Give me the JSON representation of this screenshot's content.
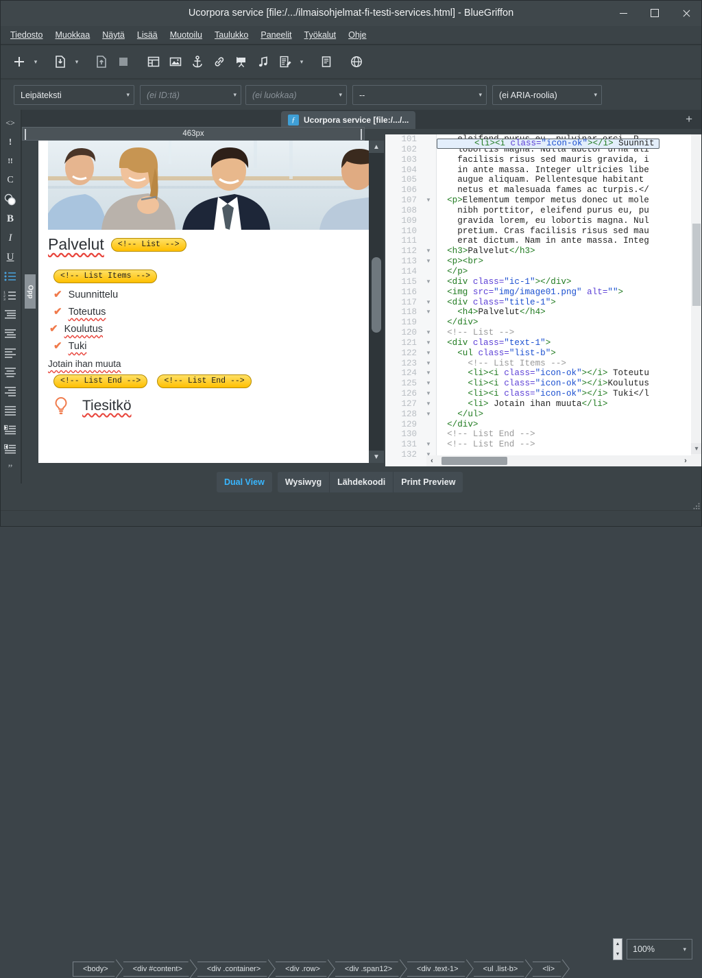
{
  "window": {
    "title": "Ucorpora service [file:/.../ilmaisohjelmat-fi-testi-services.html] - BlueGriffon",
    "minimize": "–",
    "maximize": "❐",
    "close": "✕"
  },
  "menu": {
    "items": [
      {
        "label": "Tiedosto"
      },
      {
        "label": "Muokkaa"
      },
      {
        "label": "Näytä"
      },
      {
        "label": "Lisää"
      },
      {
        "label": "Muotoilu"
      },
      {
        "label": "Taulukko"
      },
      {
        "label": "Paneelit"
      },
      {
        "label": "Työkalut"
      },
      {
        "label": "Ohje"
      }
    ]
  },
  "toolbar": {
    "buttons": [
      {
        "name": "new-document-icon",
        "glyph": "plus"
      },
      {
        "name": "new-document-dropdown-icon",
        "glyph": "caret"
      },
      {
        "name": "open-document-icon",
        "glyph": "doc-down"
      },
      {
        "name": "open-document-dropdown-icon",
        "glyph": "caret"
      },
      {
        "name": "save-document-icon",
        "glyph": "doc-up"
      },
      {
        "name": "stop-icon",
        "glyph": "square"
      },
      {
        "name": "insert-table-icon",
        "glyph": "table"
      },
      {
        "name": "insert-image-icon",
        "glyph": "image"
      },
      {
        "name": "insert-anchor-icon",
        "glyph": "anchor"
      },
      {
        "name": "insert-link-icon",
        "glyph": "link"
      },
      {
        "name": "insert-video-icon",
        "glyph": "video"
      },
      {
        "name": "insert-audio-icon",
        "glyph": "audio"
      },
      {
        "name": "insert-form-icon",
        "glyph": "form"
      },
      {
        "name": "insert-form-dropdown-icon",
        "glyph": "caret"
      },
      {
        "name": "page-properties-icon",
        "glyph": "page"
      },
      {
        "name": "browser-preview-icon",
        "glyph": "globe"
      }
    ]
  },
  "propertybar": {
    "format": {
      "value": "Leipäteksti",
      "placeholder": ""
    },
    "id": {
      "value": "",
      "placeholder": "(ei ID:tä)"
    },
    "class": {
      "value": "",
      "placeholder": "(ei luokkaa)"
    },
    "misc": {
      "value": "--",
      "placeholder": ""
    },
    "aria": {
      "value": "(ei ARIA-roolia)",
      "placeholder": ""
    }
  },
  "tabstrip": {
    "tab_label": "Ucorpora service [file:/.../...",
    "tab_icon": "flash-icon",
    "new_tab": "+"
  },
  "rail": {
    "items": [
      {
        "name": "source-code-icon",
        "glyph": "<>"
      },
      {
        "name": "exclamation-icon",
        "glyph": "!"
      },
      {
        "name": "double-exclamation-icon",
        "glyph": "!!"
      },
      {
        "name": "clear-styles-icon",
        "glyph": "C"
      },
      {
        "name": "color-picker-icon",
        "glyph": "colors"
      },
      {
        "name": "bold-icon",
        "glyph": "B"
      },
      {
        "name": "italic-icon",
        "glyph": "I"
      },
      {
        "name": "underline-icon",
        "glyph": "U"
      },
      {
        "name": "bullet-list-icon",
        "glyph": "ul"
      },
      {
        "name": "numbered-list-icon",
        "glyph": "ol"
      },
      {
        "name": "decrease-indent-icon",
        "glyph": "outdent"
      },
      {
        "name": "increase-indent-icon",
        "glyph": "indent"
      },
      {
        "name": "align-left-icon",
        "glyph": "al"
      },
      {
        "name": "align-center-icon",
        "glyph": "ac"
      },
      {
        "name": "align-right-icon",
        "glyph": "ar"
      },
      {
        "name": "align-justify-icon",
        "glyph": "aj"
      },
      {
        "name": "ltr-direction-icon",
        "glyph": "ltr"
      },
      {
        "name": "rtl-direction-icon",
        "glyph": "rtl"
      },
      {
        "name": "blockquote-icon",
        "glyph": "quote"
      }
    ]
  },
  "editor": {
    "ruler_label": "463px",
    "page_title": "Palvelut",
    "comment_list": "<!-- List -->",
    "comment_list_items": "<!-- List Items -->",
    "comment_list_end_1": "<!-- List End -->",
    "comment_list_end_2": "<!-- List End -->",
    "list_items": [
      {
        "label": "Suunnittelu",
        "icon": "check-icon"
      },
      {
        "label": "Toteutus",
        "icon": "check-icon"
      },
      {
        "label": "Koulutus",
        "icon": "check-icon"
      },
      {
        "label": "Tuki",
        "icon": "check-icon"
      }
    ],
    "plain_item": "Jotain ihan muuta",
    "tiesitko_label": "Tiesitkö",
    "tiesitko_icon": "lightbulb-icon",
    "side_tab_label": "Opp"
  },
  "source": {
    "first_line": 101,
    "selected_line": 124,
    "lines": [
      {
        "n": 101,
        "fold": false,
        "parts": [
          {
            "t": "txt",
            "s": "    eleifend purus eu, pulvinar orci. P"
          }
        ]
      },
      {
        "n": 102,
        "fold": false,
        "parts": [
          {
            "t": "txt",
            "s": "    lobortis magna. Nulla auctor urna ali"
          }
        ]
      },
      {
        "n": 103,
        "fold": false,
        "parts": [
          {
            "t": "txt",
            "s": "    facilisis risus sed mauris gravida, i"
          }
        ]
      },
      {
        "n": 104,
        "fold": false,
        "parts": [
          {
            "t": "txt",
            "s": "    in ante massa. Integer ultricies libe"
          }
        ]
      },
      {
        "n": 105,
        "fold": false,
        "parts": [
          {
            "t": "txt",
            "s": "    augue aliquam. Pellentesque habitant"
          }
        ]
      },
      {
        "n": 106,
        "fold": false,
        "parts": [
          {
            "t": "txt",
            "s": "    netus et malesuada fames ac turpis.</"
          }
        ]
      },
      {
        "n": 107,
        "fold": true,
        "parts": [
          {
            "t": "tag",
            "s": "  <p>"
          },
          {
            "t": "txt",
            "s": "Elementum tempor metus donec ut mole"
          }
        ]
      },
      {
        "n": 108,
        "fold": false,
        "parts": [
          {
            "t": "txt",
            "s": "    nibh porttitor, eleifend purus eu, pu"
          }
        ]
      },
      {
        "n": 109,
        "fold": false,
        "parts": [
          {
            "t": "txt",
            "s": "    gravida lorem, eu lobortis magna. Nul"
          }
        ]
      },
      {
        "n": 110,
        "fold": false,
        "parts": [
          {
            "t": "txt",
            "s": "    pretium. Cras facilisis risus sed mau"
          }
        ]
      },
      {
        "n": 111,
        "fold": false,
        "parts": [
          {
            "t": "txt",
            "s": "    erat dictum. Nam in ante massa. Integ"
          }
        ]
      },
      {
        "n": 112,
        "fold": true,
        "parts": [
          {
            "t": "tag",
            "s": "  <h3>"
          },
          {
            "t": "txt",
            "s": "Palvelut"
          },
          {
            "t": "tag",
            "s": "</h3>"
          }
        ]
      },
      {
        "n": 113,
        "fold": true,
        "parts": [
          {
            "t": "tag",
            "s": "  <p><br>"
          }
        ]
      },
      {
        "n": 114,
        "fold": false,
        "parts": [
          {
            "t": "tag",
            "s": "  </p>"
          }
        ]
      },
      {
        "n": 115,
        "fold": true,
        "parts": [
          {
            "t": "tag",
            "s": "  <div "
          },
          {
            "t": "attr",
            "s": "class="
          },
          {
            "t": "val",
            "s": "\"ic-1\""
          },
          {
            "t": "tag",
            "s": "></div>"
          }
        ]
      },
      {
        "n": 116,
        "fold": false,
        "parts": [
          {
            "t": "tag",
            "s": "  <img "
          },
          {
            "t": "attr",
            "s": "src="
          },
          {
            "t": "val",
            "s": "\"img/image01.png\""
          },
          {
            "t": "attr",
            "s": " alt="
          },
          {
            "t": "val",
            "s": "\"\""
          },
          {
            "t": "tag",
            "s": ">"
          }
        ]
      },
      {
        "n": 117,
        "fold": true,
        "parts": [
          {
            "t": "tag",
            "s": "  <div "
          },
          {
            "t": "attr",
            "s": "class="
          },
          {
            "t": "val",
            "s": "\"title-1\""
          },
          {
            "t": "tag",
            "s": ">"
          }
        ]
      },
      {
        "n": 118,
        "fold": true,
        "parts": [
          {
            "t": "tag",
            "s": "    <h4>"
          },
          {
            "t": "txt",
            "s": "Palvelut"
          },
          {
            "t": "tag",
            "s": "</h4>"
          }
        ]
      },
      {
        "n": 119,
        "fold": false,
        "parts": [
          {
            "t": "tag",
            "s": "  </div>"
          }
        ]
      },
      {
        "n": 120,
        "fold": true,
        "parts": [
          {
            "t": "com",
            "s": "  <!-- List -->"
          }
        ]
      },
      {
        "n": 121,
        "fold": true,
        "parts": [
          {
            "t": "tag",
            "s": "  <div "
          },
          {
            "t": "attr",
            "s": "class="
          },
          {
            "t": "val",
            "s": "\"text-1\""
          },
          {
            "t": "tag",
            "s": ">"
          }
        ]
      },
      {
        "n": 122,
        "fold": true,
        "parts": [
          {
            "t": "tag",
            "s": "    <ul "
          },
          {
            "t": "attr",
            "s": "class="
          },
          {
            "t": "val",
            "s": "\"list-b\""
          },
          {
            "t": "tag",
            "s": ">"
          }
        ]
      },
      {
        "n": 123,
        "fold": true,
        "parts": [
          {
            "t": "com",
            "s": "      <!-- List Items -->"
          }
        ]
      },
      {
        "n": 124,
        "fold": true,
        "parts": [
          {
            "t": "tag",
            "s": "      <li><i "
          },
          {
            "t": "attr",
            "s": "class="
          },
          {
            "t": "val",
            "s": "\"icon-ok\""
          },
          {
            "t": "tag",
            "s": "></i>"
          },
          {
            "t": "txt",
            "s": " Suunnit"
          }
        ]
      },
      {
        "n": 125,
        "fold": true,
        "parts": [
          {
            "t": "tag",
            "s": "      <li><i "
          },
          {
            "t": "attr",
            "s": "class="
          },
          {
            "t": "val",
            "s": "\"icon-ok\""
          },
          {
            "t": "tag",
            "s": "></i>"
          },
          {
            "t": "txt",
            "s": " Toteutu"
          }
        ]
      },
      {
        "n": 126,
        "fold": true,
        "parts": [
          {
            "t": "tag",
            "s": "      <li><i "
          },
          {
            "t": "attr",
            "s": "class="
          },
          {
            "t": "val",
            "s": "\"icon-ok\""
          },
          {
            "t": "tag",
            "s": "></i>"
          },
          {
            "t": "txt",
            "s": "Koulutus"
          }
        ]
      },
      {
        "n": 127,
        "fold": true,
        "parts": [
          {
            "t": "tag",
            "s": "      <li><i "
          },
          {
            "t": "attr",
            "s": "class="
          },
          {
            "t": "val",
            "s": "\"icon-ok\""
          },
          {
            "t": "tag",
            "s": "></i>"
          },
          {
            "t": "txt",
            "s": " Tuki</l"
          }
        ]
      },
      {
        "n": 128,
        "fold": true,
        "parts": [
          {
            "t": "tag",
            "s": "      <li>"
          },
          {
            "t": "txt",
            "s": " Jotain ihan muuta"
          },
          {
            "t": "tag",
            "s": "</li>"
          }
        ]
      },
      {
        "n": 129,
        "fold": false,
        "parts": [
          {
            "t": "tag",
            "s": "    </ul>"
          }
        ]
      },
      {
        "n": 130,
        "fold": false,
        "parts": [
          {
            "t": "tag",
            "s": "  </div>"
          }
        ]
      },
      {
        "n": 131,
        "fold": true,
        "parts": [
          {
            "t": "com",
            "s": "  <!-- List End -->"
          }
        ]
      },
      {
        "n": 132,
        "fold": true,
        "parts": [
          {
            "t": "com",
            "s": "  <!-- List End -->"
          }
        ]
      }
    ]
  },
  "viewmodes": {
    "tabs": [
      {
        "label": "Dual View",
        "active": true
      },
      {
        "label": "Wysiwyg",
        "active": false
      },
      {
        "label": "Lähdekoodi",
        "active": false
      },
      {
        "label": "Print Preview",
        "active": false
      }
    ]
  },
  "statusbar": {
    "zoom": "100%",
    "breadcrumbs": [
      "<body>",
      "<div #content>",
      "<div .container>",
      "<div .row>",
      "<div .span12>",
      "<div .text-1>",
      "<ul .list-b>",
      "<li>"
    ]
  },
  "colors": {
    "chrome": "#3b4347",
    "titlebar": "#3f474b",
    "accent": "#38b6ff",
    "comment_badge": "#ffcc00",
    "check": "#f07a4b",
    "spell_underline": "#e8453c"
  }
}
